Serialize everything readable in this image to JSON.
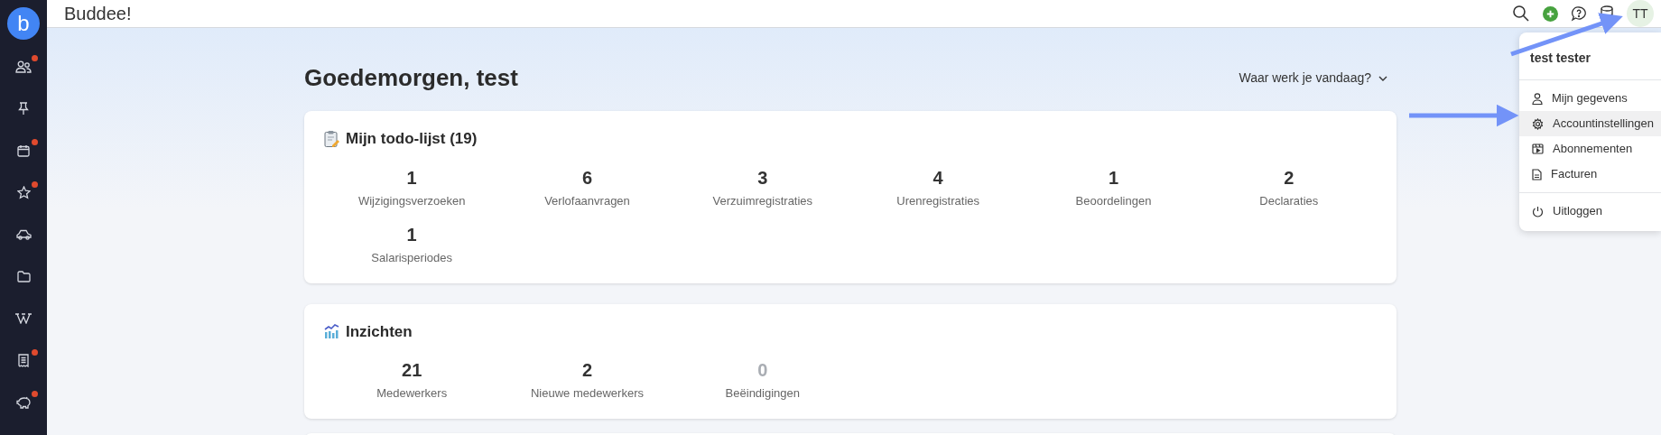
{
  "app": {
    "title": "Buddee!",
    "logo_letter": "b"
  },
  "sidebar": {
    "items": [
      {
        "badge": true
      },
      {
        "badge": false
      },
      {
        "badge": true
      },
      {
        "badge": true
      },
      {
        "badge": false
      },
      {
        "badge": false
      },
      {
        "badge": false
      },
      {
        "badge": true
      },
      {
        "badge": true
      }
    ]
  },
  "topbar": {
    "avatar": "TT"
  },
  "greeting": "Goedemorgen, test",
  "location_picker": "Waar werk je vandaag?",
  "todo": {
    "title": "Mijn todo-lijst (19)",
    "items": [
      {
        "count": "1",
        "label": "Wijzigingsverzoeken"
      },
      {
        "count": "6",
        "label": "Verlofaanvragen"
      },
      {
        "count": "3",
        "label": "Verzuimregistraties"
      },
      {
        "count": "4",
        "label": "Urenregistraties"
      },
      {
        "count": "1",
        "label": "Beoordelingen"
      },
      {
        "count": "2",
        "label": "Declaraties"
      },
      {
        "count": "1",
        "label": "Salarisperiodes"
      }
    ]
  },
  "insights": {
    "title": "Inzichten",
    "items": [
      {
        "count": "21",
        "label": "Medewerkers",
        "dimmed": false
      },
      {
        "count": "2",
        "label": "Nieuwe medewerkers",
        "dimmed": false
      },
      {
        "count": "0",
        "label": "Beëindigingen",
        "dimmed": true
      }
    ]
  },
  "user_menu": {
    "name": "test tester",
    "sections": [
      [
        {
          "label": "Mijn gegevens",
          "selected": false
        },
        {
          "label": "Accountinstellingen",
          "selected": true
        },
        {
          "label": "Abonnementen",
          "selected": false
        },
        {
          "label": "Facturen",
          "selected": false
        }
      ],
      [
        {
          "label": "Uitloggen",
          "selected": false
        }
      ]
    ]
  }
}
